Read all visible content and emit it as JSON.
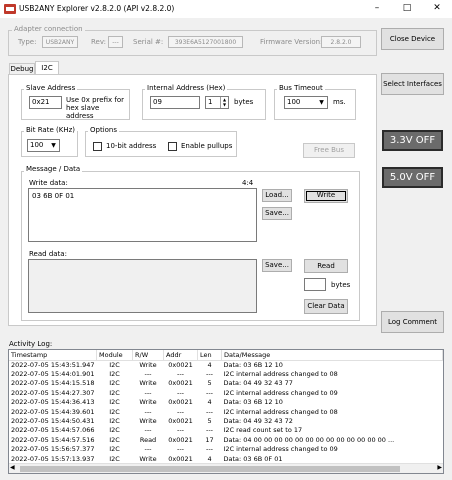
{
  "window": {
    "title": "USB2ANY Explorer v2.8.2.0  (API v2.8.2.0)"
  },
  "adapter": {
    "group_label": "Adapter connection",
    "type_label": "Type:",
    "type_value": "USB2ANY",
    "rev_label": "Rev:",
    "rev_value": "---",
    "serial_label": "Serial #:",
    "serial_value": "393E6A5127001800",
    "fw_label": "Firmware Version:",
    "fw_value": "2.8.2.0"
  },
  "tabs": [
    "Debug",
    "I2C"
  ],
  "slave": {
    "label": "Slave Address",
    "value": "0x21",
    "hint": "Use 0x prefix for hex slave address"
  },
  "internal": {
    "label": "Internal Address (Hex)",
    "value": "09",
    "count": "1",
    "unit": "bytes"
  },
  "timeout": {
    "label": "Bus Timeout",
    "value": "100",
    "unit": "ms."
  },
  "bitrate": {
    "label": "Bit Rate (KHz)",
    "value": "100"
  },
  "options": {
    "label": "Options",
    "tenbit": "10-bit address",
    "pullups": "Enable pullups"
  },
  "buttons": {
    "free_bus": "Free Bus",
    "close_device": "Close Device",
    "select_interfaces": "Select Interfaces",
    "load": "Load...",
    "save": "Save...",
    "write": "Write",
    "save2": "Save...",
    "read": "Read",
    "clear": "Clear Data",
    "log_comment": "Log Comment"
  },
  "status": {
    "v33": "3.3V OFF",
    "v50": "5.0V OFF"
  },
  "message": {
    "group_label": "Message / Data",
    "write_label": "Write data:",
    "write_counter": "4:4",
    "write_value": "03 6B 0F 01",
    "read_label": "Read data:",
    "bytes_label": "bytes"
  },
  "log": {
    "label": "Activity Log:",
    "columns": [
      "Timestamp",
      "Module",
      "R/W",
      "Addr",
      "Len",
      "Data/Message"
    ],
    "rows": [
      [
        "2022-07-05 15:43:51.947",
        "I2C",
        "Write",
        "0x0021",
        "4",
        "Data: 03 6B 12 10"
      ],
      [
        "2022-07-05 15:44:01.901",
        "I2C",
        "---",
        "---",
        "---",
        "I2C internal address changed to 08"
      ],
      [
        "2022-07-05 15:44:15.518",
        "I2C",
        "Write",
        "0x0021",
        "5",
        "Data: 04 49 32 43 77"
      ],
      [
        "2022-07-05 15:44:27.307",
        "I2C",
        "---",
        "---",
        "---",
        "I2C internal address changed to 09"
      ],
      [
        "2022-07-05 15:44:36.413",
        "I2C",
        "Write",
        "0x0021",
        "4",
        "Data: 03 6B 12 10"
      ],
      [
        "2022-07-05 15:44:39.601",
        "I2C",
        "---",
        "---",
        "---",
        "I2C internal address changed to 08"
      ],
      [
        "2022-07-05 15:44:50.431",
        "I2C",
        "Write",
        "0x0021",
        "5",
        "Data: 04 49 32 43 72"
      ],
      [
        "2022-07-05 15:44:57.066",
        "I2C",
        "---",
        "---",
        "---",
        "I2C read count set to 17"
      ],
      [
        "2022-07-05 15:44:57.516",
        "I2C",
        "Read",
        "0x0021",
        "17",
        "Data: 04 00 00 00 00 00 00 00 00 00 00 00 00 00 ..."
      ],
      [
        "2022-07-05 15:56:57.377",
        "I2C",
        "---",
        "---",
        "---",
        "I2C internal address changed to 09"
      ],
      [
        "2022-07-05 15:57:13.937",
        "I2C",
        "Write",
        "0x0021",
        "4",
        "Data: 03 6B 0F 01"
      ]
    ]
  }
}
